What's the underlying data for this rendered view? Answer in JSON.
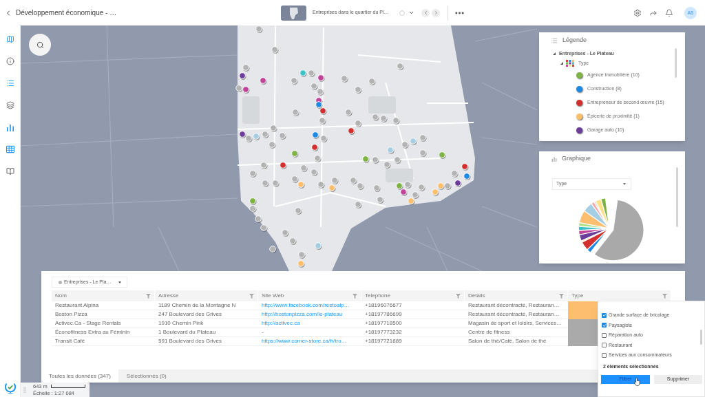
{
  "top_bar": {
    "title": "Développement économique - …",
    "map_title": "Entreprises dans le quartier du Pl…",
    "avatar": "AS"
  },
  "sidebar": {
    "items": [
      {
        "selected": true
      },
      {
        "selected": false
      },
      {
        "selected": true
      },
      {
        "selected": false
      },
      {
        "selected": true
      },
      {
        "selected": true
      },
      {
        "selected": false
      }
    ]
  },
  "legend": {
    "title": "Légende",
    "layers": [
      {
        "label": "Entreprises - Le Plateau",
        "expanded": true,
        "children": [
          {
            "label": "Type",
            "expanded": true,
            "children": [
              {
                "label": "Agence immobilière (10)",
                "color": "#7cb342"
              },
              {
                "label": "Construction (8)",
                "color": "#1e88e5"
              },
              {
                "label": "Entrepreneur de second œuvre (15)",
                "color": "#d32f2f"
              },
              {
                "label": "Épicerie de proximité (1)",
                "color": "#ffbe6a"
              },
              {
                "label": "Garage auto (10)",
                "color": "#6a3d9a"
              }
            ]
          }
        ]
      }
    ]
  },
  "chart_panel": {
    "title": "Graphique",
    "select": {
      "value": "Type"
    }
  },
  "table": {
    "layer_select": {
      "value": "Entreprises - Le Pla…"
    },
    "columns": [
      "Nom",
      "Adresse",
      "Site Web",
      "Telephone",
      "Détails",
      "Type"
    ],
    "rows": [
      {
        "name": "Restaurant Alpina",
        "address": "1189 Chemin de la Montagne N",
        "website": {
          "text": "http://www.facebook.com/restoalp…",
          "kind": "link"
        },
        "phone": "+18196076677",
        "details": "Restaurant décontracté, Restauran…",
        "color": "#fdbf6f"
      },
      {
        "name": "Boston Pizza",
        "address": "247 Boulevard des Grives",
        "website": {
          "text": "http://bostonpizza.com/le-plateau",
          "kind": "link"
        },
        "phone": "+18197786699",
        "details": "Restaurant décontracté, Restauran…",
        "color": "#fdbf6f"
      },
      {
        "name": "Activec.Ca - Stage Rentals",
        "address": "1910 Chemin Pink",
        "website": {
          "text": "http://activec.ca",
          "kind": "link"
        },
        "phone": "+18197718500",
        "details": "Magasin de sport et loisirs, Services…",
        "color": "#aaaaaa"
      },
      {
        "name": "Éconofitness Extra au Féminin",
        "address": "1 Boulevard du Plateau",
        "website": {
          "text": "-",
          "kind": "plain"
        },
        "phone": "+18197773232",
        "details": "Centre de fitness",
        "color": "#aaaaaa"
      },
      {
        "name": "Transit Café",
        "address": "591 Boulevard des Grives",
        "website": {
          "text": "https://www.corner-store.ca/fr/tro…",
          "kind": "link"
        },
        "phone": "+18197721889",
        "details": "Salon de thé/Café, Salon de thé",
        "color": "#aaaaaa"
      }
    ],
    "tabs": [
      {
        "label": "Toutes les données (347)",
        "selected": true
      },
      {
        "label": "Sélectionnés (0)",
        "selected": false
      }
    ]
  },
  "type_filter": {
    "options": [
      {
        "label": "Grande surface de bricolage",
        "checked": true
      },
      {
        "label": "Paysagiste",
        "checked": true
      },
      {
        "label": "Réparation auto",
        "checked": false
      },
      {
        "label": "Restaurant",
        "checked": false
      },
      {
        "label": "Services aux consommateurs",
        "checked": false
      }
    ],
    "summary": "2 éléments sélectionnés",
    "buttons": [
      {
        "label": "Filtrer",
        "kind": "primary"
      },
      {
        "label": "Supprimer",
        "kind": "secondary"
      }
    ]
  },
  "scale": {
    "distance": "643 m",
    "ratio": "Échelle : 1:27 084"
  }
}
